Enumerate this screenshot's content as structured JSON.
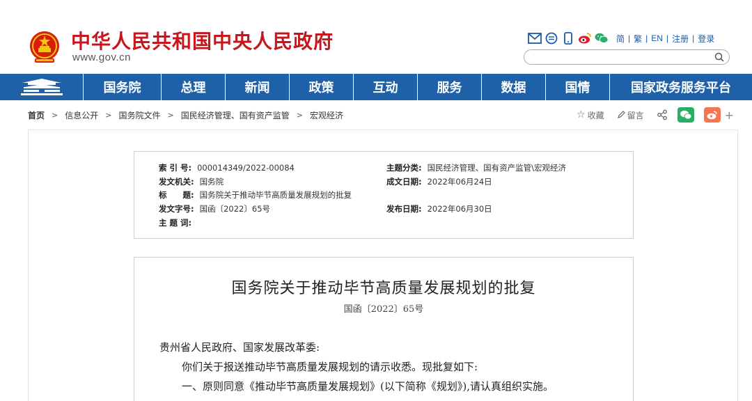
{
  "header": {
    "site_title": "中华人民共和国中央人民政府",
    "site_url": "www.gov.cn",
    "util_icons": [
      "mail-icon",
      "chat-bubble-icon",
      "mobile-phone-icon",
      "weibo-icon",
      "wechat-icon"
    ],
    "util_links": [
      "简",
      "繁",
      "EN",
      "注册",
      "登录"
    ],
    "search": {
      "placeholder": ""
    }
  },
  "nav": {
    "items": [
      "总理",
      "新闻",
      "政策",
      "互动",
      "服务",
      "数据",
      "国情",
      "国家政务服务平台"
    ],
    "first": "国务院"
  },
  "breadcrumb": {
    "items": [
      "首页",
      "信息公开",
      "国务院文件",
      "国民经济管理、国有资产监管",
      "宏观经济"
    ]
  },
  "share": {
    "favorite": "收藏",
    "comment": "留言"
  },
  "info": {
    "index_label": "索 引 号:",
    "index_value": "000014349/2022-00084",
    "org_label": "发文机关:",
    "org_value": "国务院",
    "title_label": "标　　题:",
    "title_value": "国务院关于推动毕节高质量发展规划的批复",
    "docno_label": "发文字号:",
    "docno_value": "国函〔2022〕65号",
    "keywords_label": "主 题 词:",
    "keywords_value": "",
    "category_label": "主题分类:",
    "category_value": "国民经济管理、国有资产监管\\宏观经济",
    "created_label": "成文日期:",
    "created_value": "2022年06月24日",
    "published_label": "发布日期:",
    "published_value": "2022年06月30日"
  },
  "doc": {
    "title": "国务院关于推动毕节高质量发展规划的批复",
    "number": "国函〔2022〕65号",
    "salutation": "贵州省人民政府、国家发展改革委:",
    "p1": "你们关于报送推动毕节高质量发展规划的请示收悉。现批复如下:",
    "p2": "一、原则同意《推动毕节高质量发展规划》(以下简称《规划》),请认真组织实施。"
  },
  "colors": {
    "brand_red": "#c8161d",
    "nav_blue": "#1e61a9",
    "link_blue": "#1a5ba8",
    "wechat_green": "#2aae67",
    "weibo_orange": "#f4754f"
  }
}
